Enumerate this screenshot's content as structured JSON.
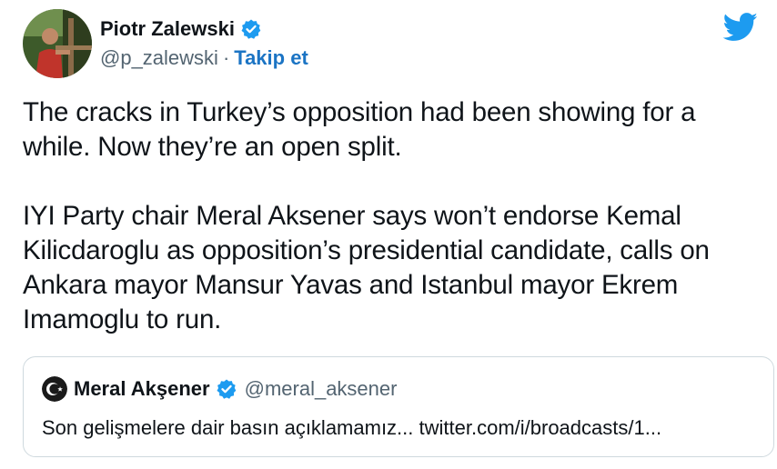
{
  "tweet": {
    "author": {
      "name": "Piotr Zalewski",
      "handle": "@p_zalewski",
      "separator": "·",
      "follow_label": "Takip et"
    },
    "paragraphs": [
      "The cracks in Turkey’s opposition had been showing for a while. Now they’re an open split.",
      "IYI Party chair Meral Aksener says won’t endorse Kemal Kilicdaroglu as opposition’s presidential candidate, calls on Ankara mayor Mansur Yavas and Istanbul mayor Ekrem Imamoglu to run."
    ],
    "quoted": {
      "name": "Meral Akşener",
      "handle": "@meral_aksener",
      "text": "Son gelişmelere dair basın açıklamamız... twitter.com/i/broadcasts/1..."
    }
  },
  "colors": {
    "accent": "#1d9bf0",
    "link": "#1b74c4",
    "muted": "#536471",
    "border": "#cfd9de"
  },
  "icons": {
    "brand": "twitter-bird-icon",
    "verified": "verified-badge-icon"
  }
}
